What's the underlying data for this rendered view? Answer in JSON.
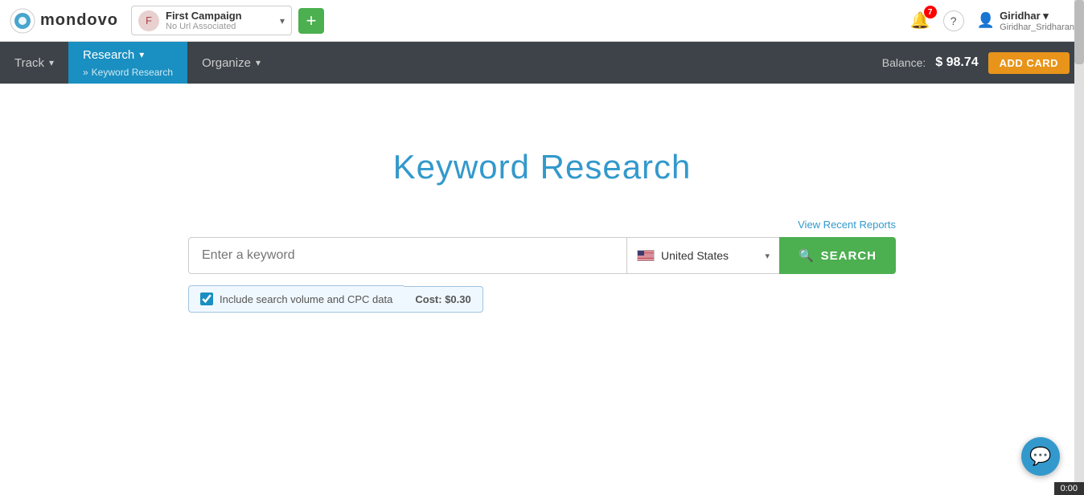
{
  "logo": {
    "text": "mondovo"
  },
  "campaign": {
    "name": "First Campaign",
    "url": "No Url Associated",
    "arrow": "▾"
  },
  "topbar": {
    "add_button": "+",
    "notifications": {
      "count": "7",
      "icon": "🔔"
    },
    "help_icon": "?",
    "user": {
      "display": "Giridhar ▾",
      "sub": "Giridhar_Sridharan"
    }
  },
  "navbar": {
    "items": [
      {
        "label": "Track",
        "arrow": "▾",
        "active": false
      },
      {
        "label": "Research",
        "arrow": "▾",
        "active": true,
        "sub": "Keyword Research"
      },
      {
        "label": "Organize",
        "arrow": "▾",
        "active": false
      }
    ],
    "balance_label": "Balance:",
    "balance_amount": "$ 98.74",
    "add_card_label": "ADD CARD"
  },
  "main": {
    "page_title": "Keyword Research",
    "view_recent": "View Recent Reports",
    "search_placeholder": "Enter a keyword",
    "country": "United States",
    "search_button": "SEARCH",
    "checkbox_label": "Include search volume and CPC data",
    "cost_label": "Cost: $0.30"
  },
  "chat": {
    "icon": "💬"
  },
  "bottom_bar": {
    "time": "0:00"
  }
}
